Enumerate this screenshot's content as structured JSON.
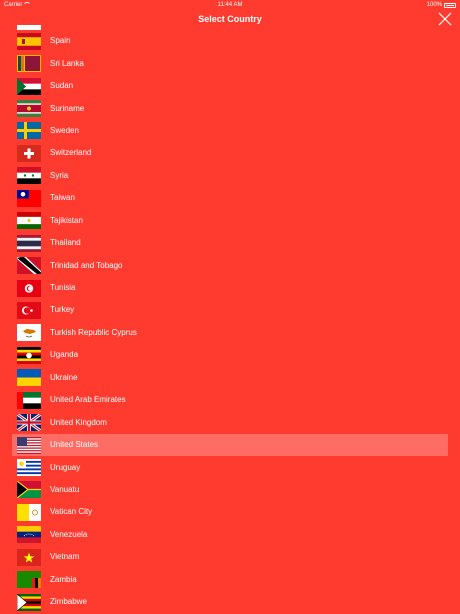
{
  "status": {
    "carrier": "Carrier",
    "time": "11:44 AM",
    "battery": "100%"
  },
  "nav": {
    "title": "Select Country"
  },
  "countries": [
    {
      "name": "Spain",
      "flag": "spain"
    },
    {
      "name": "Sri Lanka",
      "flag": "srilanka"
    },
    {
      "name": "Sudan",
      "flag": "sudan"
    },
    {
      "name": "Suriname",
      "flag": "suriname"
    },
    {
      "name": "Sweden",
      "flag": "sweden"
    },
    {
      "name": "Switzerland",
      "flag": "switzerland"
    },
    {
      "name": "Syria",
      "flag": "syria"
    },
    {
      "name": "Taiwan",
      "flag": "taiwan"
    },
    {
      "name": "Tajikistan",
      "flag": "tajikistan"
    },
    {
      "name": "Thailand",
      "flag": "thailand"
    },
    {
      "name": "Trinidad and Tobago",
      "flag": "trinidad"
    },
    {
      "name": "Tunisia",
      "flag": "tunisia"
    },
    {
      "name": "Turkey",
      "flag": "turkey"
    },
    {
      "name": "Turkish Republic Cyprus",
      "flag": "cyprus"
    },
    {
      "name": "Uganda",
      "flag": "uganda"
    },
    {
      "name": "Ukraine",
      "flag": "ukraine"
    },
    {
      "name": "United Arab Emirates",
      "flag": "uae"
    },
    {
      "name": "United Kingdom",
      "flag": "uk"
    },
    {
      "name": "United States",
      "flag": "usa",
      "selected": true
    },
    {
      "name": "Uruguay",
      "flag": "uruguay"
    },
    {
      "name": "Vanuatu",
      "flag": "vanuatu"
    },
    {
      "name": "Vatican City",
      "flag": "vatican"
    },
    {
      "name": "Venezuela",
      "flag": "venezuela"
    },
    {
      "name": "Vietnam",
      "flag": "vietnam"
    },
    {
      "name": "Zambia",
      "flag": "zambia"
    },
    {
      "name": "Zimbabwe",
      "flag": "zimbabwe"
    }
  ]
}
